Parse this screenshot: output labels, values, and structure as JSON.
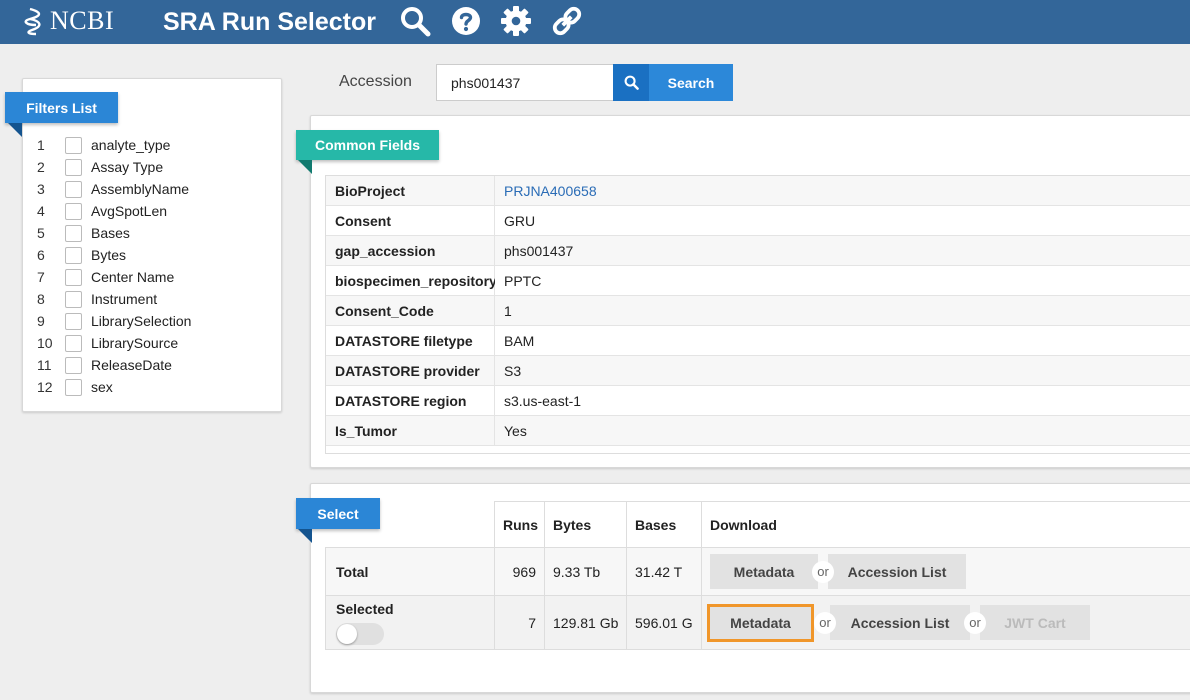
{
  "header": {
    "logo_text": "NCBI",
    "title": "SRA Run Selector",
    "icons": [
      "search-icon",
      "help-icon",
      "gear-icon",
      "link-icon"
    ],
    "color": "#336699"
  },
  "filters": {
    "title": "Filters List",
    "items": [
      {
        "num": "1",
        "label": "analyte_type"
      },
      {
        "num": "2",
        "label": "Assay Type"
      },
      {
        "num": "3",
        "label": "AssemblyName"
      },
      {
        "num": "4",
        "label": "AvgSpotLen"
      },
      {
        "num": "5",
        "label": "Bases"
      },
      {
        "num": "6",
        "label": "Bytes"
      },
      {
        "num": "7",
        "label": "Center Name"
      },
      {
        "num": "8",
        "label": "Instrument"
      },
      {
        "num": "9",
        "label": "LibrarySelection"
      },
      {
        "num": "10",
        "label": "LibrarySource"
      },
      {
        "num": "11",
        "label": "ReleaseDate"
      },
      {
        "num": "12",
        "label": "sex"
      }
    ]
  },
  "accession": {
    "label": "Accession",
    "value": "phs001437",
    "search_label": "Search"
  },
  "common_fields": {
    "title": "Common Fields",
    "rows": [
      {
        "key": "BioProject",
        "value": "PRJNA400658",
        "link": true
      },
      {
        "key": "Consent",
        "value": "GRU"
      },
      {
        "key": "gap_accession",
        "value": "phs001437"
      },
      {
        "key": "biospecimen_repository",
        "value": "PPTC"
      },
      {
        "key": "Consent_Code",
        "value": "1"
      },
      {
        "key": "DATASTORE filetype",
        "value": "BAM"
      },
      {
        "key": "DATASTORE provider",
        "value": "S3"
      },
      {
        "key": "DATASTORE region",
        "value": "s3.us-east-1"
      },
      {
        "key": "Is_Tumor",
        "value": "Yes"
      }
    ]
  },
  "select": {
    "title": "Select",
    "headers": {
      "runs": "Runs",
      "bytes": "Bytes",
      "bases": "Bases",
      "download": "Download"
    },
    "total": {
      "label": "Total",
      "runs": "969",
      "bytes": "9.33 Tb",
      "bases": "31.42 T"
    },
    "selected": {
      "label": "Selected",
      "runs": "7",
      "bytes": "129.81 Gb",
      "bases": "596.01 G",
      "toggle_on": false
    },
    "buttons": {
      "metadata": "Metadata",
      "accession_list": "Accession List",
      "jwt_cart": "JWT Cart",
      "or": "or"
    }
  },
  "colors": {
    "blue_ribbon": "#2b86d6",
    "teal_ribbon": "#26b8a8",
    "highlight": "#f0962a",
    "link": "#2a6cb6"
  }
}
